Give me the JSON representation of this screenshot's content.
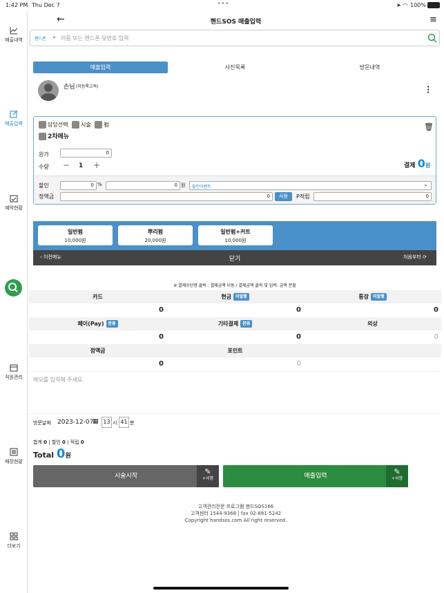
{
  "status": {
    "time": "1:42 PM",
    "date": "Thu Dec 7",
    "battery": "100%"
  },
  "sidebar": {
    "items": [
      {
        "label": "매출내역"
      },
      {
        "label": "매출입력"
      },
      {
        "label": "예약현황"
      },
      {
        "label": "직원관리"
      },
      {
        "label": "매장현황"
      },
      {
        "label": "더보기"
      }
    ]
  },
  "header": {
    "title": "핸드SOS 매출입력"
  },
  "search": {
    "type": "핸드폰",
    "placeholder": "이름 또는 핸드폰 뒷번호 입력"
  },
  "tabs": [
    "매출입력",
    "사진목록",
    "방문내역"
  ],
  "customer": {
    "name": "손님",
    "note": "(미등록고객)"
  },
  "sale": {
    "tags": [
      "담당선택",
      "시술",
      "펌"
    ],
    "submenu": "2차메뉴",
    "price_label": "원가",
    "price": "0",
    "qty_label": "수량",
    "qty": "1",
    "pay_label": "결제",
    "pay_value": "0",
    "pay_unit": "원",
    "discount_label": "할인",
    "discount_pct": "0",
    "pct": "%",
    "discount_amt": "0",
    "won": "원",
    "event": "할인이벤트",
    "fixed_label": "정액금",
    "fixed": "0",
    "use": "사용",
    "p_label": "P적립",
    "p": "0"
  },
  "menu": {
    "items": [
      {
        "name": "일반펌",
        "price": "10,000원"
      },
      {
        "name": "뿌리펌",
        "price": "20,000원"
      },
      {
        "name": "일반펌+커트",
        "price": "10,000원"
      }
    ],
    "prev": "이전메뉴",
    "close": "닫기",
    "reset": "처음부터"
  },
  "payment": {
    "note": "※ 결제수단명 클릭 : 결제금액 이동 / 결제금액 클릭 및 입력: 금액 분할",
    "card": "카드",
    "cash": "현금",
    "account": "통장",
    "unissued": "미발행",
    "pay": "페이(Pay)",
    "other": "기타결제",
    "credit": "외상",
    "split": "분류",
    "fixed": "정액금",
    "point": "포인트",
    "zero": "0"
  },
  "memo": {
    "placeholder": "메모를 입력해 주세요."
  },
  "visit": {
    "label": "방문날짜",
    "date": "2023-12-07",
    "hour": "13",
    "hour_unit": "시",
    "min": "41",
    "min_unit": "분"
  },
  "totals": {
    "sum_label": "합계",
    "sum": "0",
    "disc_label": "할인",
    "disc": "0",
    "acc_label": "적립",
    "acc": "0",
    "total_label": "Total",
    "total": "0",
    "unit": "원"
  },
  "buttons": {
    "start": "시술시작",
    "submit": "매출입력",
    "sign": "+서명"
  },
  "footer": {
    "l1": "고객관리전문 프로그램 핸드SOS166",
    "l2": "고객센터 1544-9368 | fax 02-881-5242",
    "l3": "Copyright handsos.com All right reserved."
  }
}
